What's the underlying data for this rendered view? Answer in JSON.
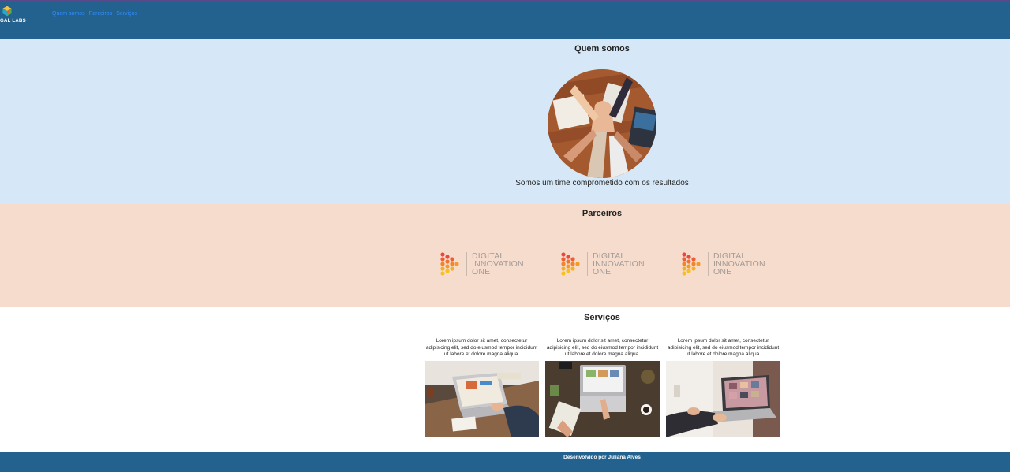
{
  "header": {
    "logo_text": "GAL LABS",
    "nav": [
      "Quem somos",
      "Parceiros",
      "Serviços"
    ]
  },
  "about": {
    "title": "Quem somos",
    "caption": "Somos um time comprometido com os resultados"
  },
  "partners": {
    "title": "Parceiros",
    "items": [
      {
        "line1": "DIGITAL",
        "line2": "INNOVATION",
        "line3": "ONE"
      },
      {
        "line1": "DIGITAL",
        "line2": "INNOVATION",
        "line3": "ONE"
      },
      {
        "line1": "DIGITAL",
        "line2": "INNOVATION",
        "line3": "ONE"
      }
    ]
  },
  "services": {
    "title": "Serviços",
    "items": [
      {
        "text": "Lorem ipsum dolor sit amet, consectetur adipisicing elit, sed do eiusmod tempor incididunt ut labore et dolore magna aliqua."
      },
      {
        "text": "Lorem ipsum dolor sit amet, consectetur adipisicing elit, sed do eiusmod tempor incididunt ut labore et dolore magna aliqua."
      },
      {
        "text": "Lorem ipsum dolor sit amet, consectetur adipisicing elit, sed do eiusmod tempor incididunt ut labore et dolore magna aliqua."
      }
    ]
  },
  "footer": {
    "text": "Desenvolvido por Juliana Alves"
  },
  "colors": {
    "header": "#23628f",
    "about_bg": "#d6e8f7",
    "partners_bg": "#f6dccd",
    "nav_link": "#2f8cff"
  }
}
